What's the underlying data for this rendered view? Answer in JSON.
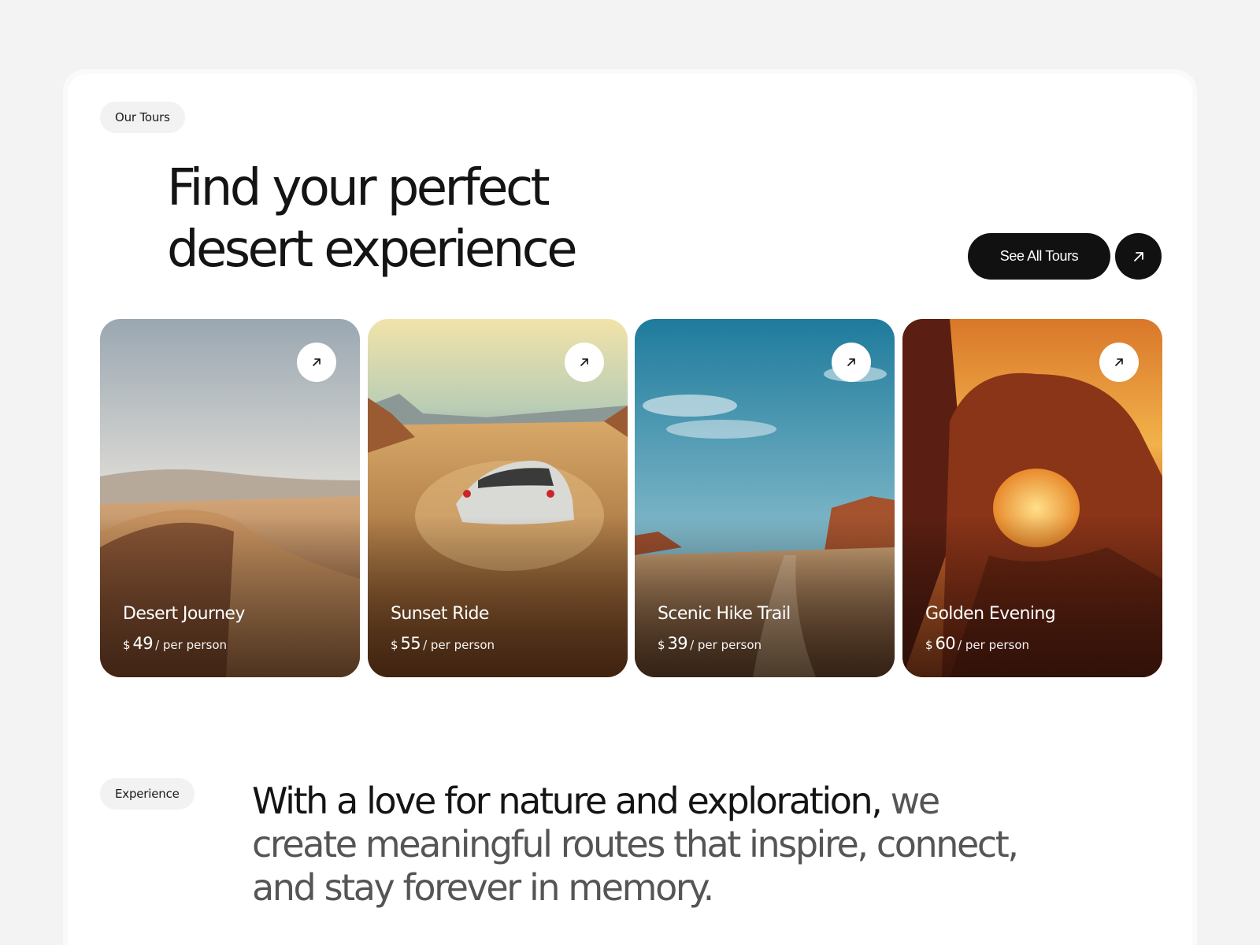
{
  "header": {
    "badge": "Our Tours",
    "headline_line1": "Find your perfect",
    "headline_line2": "desert experience",
    "cta_label": "See All Tours",
    "cta_icon": "arrow-up-right-icon"
  },
  "tours": [
    {
      "title": "Desert Journey",
      "currency": "$",
      "price": "49",
      "unit": "/ per person",
      "icon": "arrow-up-right-icon"
    },
    {
      "title": "Sunset Ride",
      "currency": "$",
      "price": "55",
      "unit": "/ per person",
      "icon": "arrow-up-right-icon"
    },
    {
      "title": "Scenic Hike Trail",
      "currency": "$",
      "price": "39",
      "unit": "/ per person",
      "icon": "arrow-up-right-icon"
    },
    {
      "title": "Golden Evening",
      "currency": "$",
      "price": "60",
      "unit": "/ per person",
      "icon": "arrow-up-right-icon"
    }
  ],
  "experience": {
    "badge": "Experience",
    "statement_strong": "With a love for nature and exploration,",
    "statement_rest": " we create meaningful routes that inspire, connect, and stay forever in memory."
  },
  "colors": {
    "page_background": "#f3f3f3",
    "panel": "#ffffff",
    "pill": "#f2f2f2",
    "button_dark": "#111111",
    "text_primary": "#141414",
    "text_secondary": "#555555"
  }
}
